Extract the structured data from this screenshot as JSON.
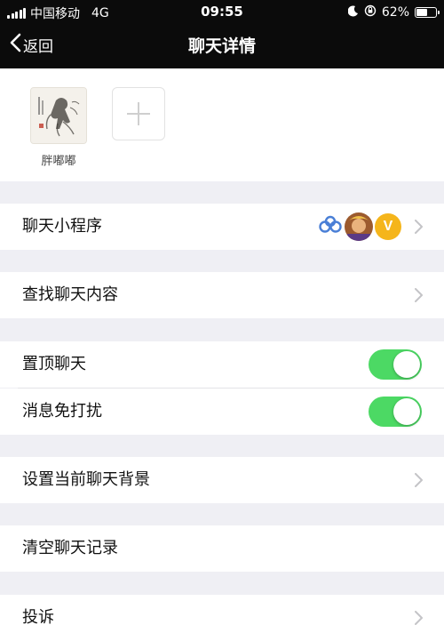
{
  "status_bar": {
    "carrier": "中国移动",
    "network": "4G",
    "time": "09:55",
    "battery_percent_label": "62%",
    "battery_level": 0.62
  },
  "nav": {
    "back_label": "返回",
    "title": "聊天详情"
  },
  "members": [
    {
      "name": "胖嘟嘟"
    }
  ],
  "mini_program_row": {
    "label": "聊天小程序",
    "badge_text": "V"
  },
  "search_row": {
    "label": "查找聊天内容"
  },
  "sticky_row": {
    "label": "置顶聊天",
    "on": true
  },
  "mute_row": {
    "label": "消息免打扰",
    "on": true
  },
  "background_row": {
    "label": "设置当前聊天背景"
  },
  "clear_row": {
    "label": "清空聊天记录"
  },
  "report_row": {
    "label": "投诉"
  },
  "colors": {
    "toggle_on": "#4cd964",
    "badge": "#f5b51b",
    "mini_program_icon": "#4a7fd6"
  },
  "icons": [
    "signal-icon",
    "moon-icon",
    "orientation-lock-icon",
    "battery-icon",
    "chevron-left-icon",
    "plus-icon",
    "chevron-right-icon",
    "mini-program-icon"
  ]
}
